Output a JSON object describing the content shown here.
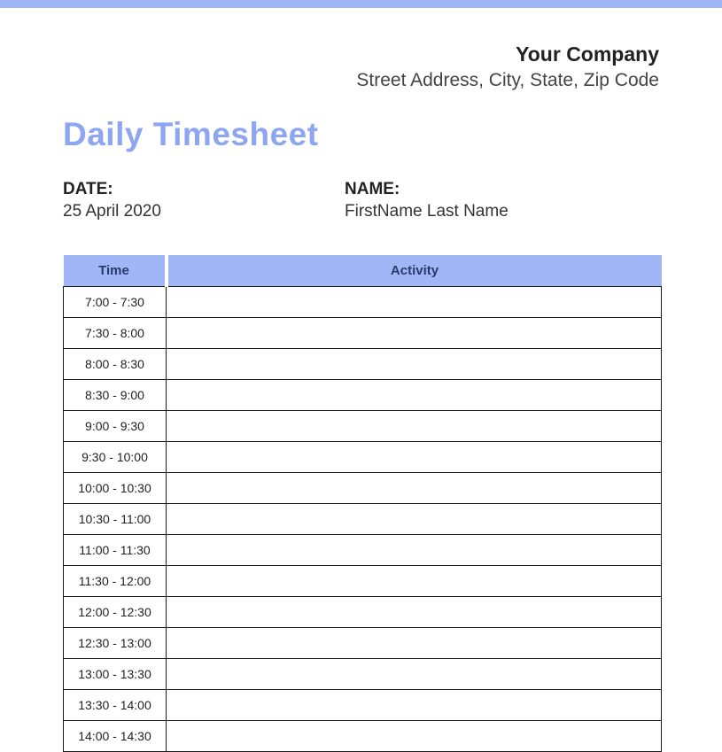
{
  "header": {
    "company_name": "Your Company",
    "company_address": "Street Address, City, State, Zip Code"
  },
  "title": "Daily Timesheet",
  "info": {
    "date_label": "DATE:",
    "date_value": "25 April 2020",
    "name_label": "NAME:",
    "name_value": "FirstName Last Name"
  },
  "table": {
    "headers": {
      "time": "Time",
      "activity": "Activity"
    },
    "rows": [
      {
        "time": "7:00 - 7:30",
        "activity": ""
      },
      {
        "time": "7:30 - 8:00",
        "activity": ""
      },
      {
        "time": "8:00 - 8:30",
        "activity": ""
      },
      {
        "time": "8:30 - 9:00",
        "activity": ""
      },
      {
        "time": "9:00 - 9:30",
        "activity": ""
      },
      {
        "time": "9:30 - 10:00",
        "activity": ""
      },
      {
        "time": "10:00 - 10:30",
        "activity": ""
      },
      {
        "time": "10:30 - 11:00",
        "activity": ""
      },
      {
        "time": "11:00 - 11:30",
        "activity": ""
      },
      {
        "time": "11:30 - 12:00",
        "activity": ""
      },
      {
        "time": "12:00 - 12:30",
        "activity": ""
      },
      {
        "time": "12:30 - 13:00",
        "activity": ""
      },
      {
        "time": "13:00 - 13:30",
        "activity": ""
      },
      {
        "time": "13:30 - 14:00",
        "activity": ""
      },
      {
        "time": "14:00 - 14:30",
        "activity": ""
      }
    ]
  }
}
